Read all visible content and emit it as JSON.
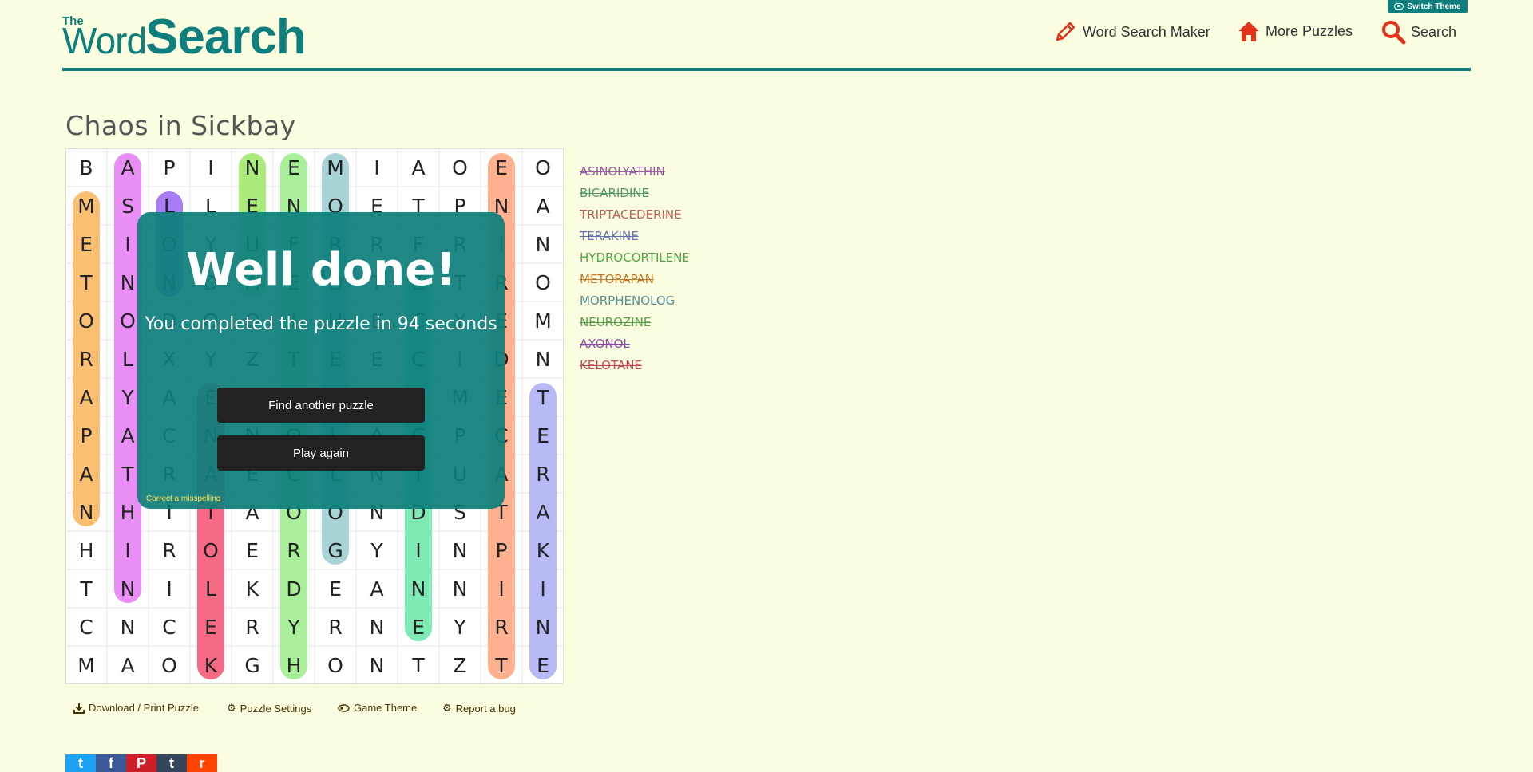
{
  "header": {
    "switch_theme": "Switch Theme",
    "logo_the": "The",
    "logo_word": "Word",
    "logo_search": "Search",
    "nav_maker": "Word Search Maker",
    "nav_more": "More Puzzles",
    "nav_search": "Search"
  },
  "puzzle": {
    "title": "Chaos in Sickbay",
    "rows": [
      [
        "B",
        "A",
        "P",
        "I",
        "N",
        "E",
        "M",
        "I",
        "A",
        "O",
        "E",
        "O"
      ],
      [
        "M",
        "S",
        "L",
        "L",
        "E",
        "N",
        "O",
        "E",
        "T",
        "P",
        "N",
        "A"
      ],
      [
        "E",
        "I",
        "O",
        "Y",
        "U",
        "F",
        "R",
        "R",
        "F",
        "R",
        "I",
        "N"
      ],
      [
        "T",
        "N",
        "N",
        "D",
        "A",
        "E",
        "O",
        "T",
        "E",
        "T",
        "R",
        "O"
      ],
      [
        "O",
        "O",
        "D",
        "O",
        "O",
        "I",
        "H",
        "E",
        "C",
        "Y",
        "E",
        "M"
      ],
      [
        "R",
        "L",
        "X",
        "Y",
        "Z",
        "T",
        "E",
        "E",
        "C",
        "I",
        "D",
        "N"
      ],
      [
        "A",
        "Y",
        "A",
        "E",
        "Z",
        "U",
        "O",
        "D",
        "C",
        "M",
        "E",
        "T"
      ],
      [
        "P",
        "A",
        "C",
        "N",
        "N",
        "O",
        "L",
        "A",
        "C",
        "P",
        "C",
        "E"
      ],
      [
        "A",
        "T",
        "R",
        "A",
        "E",
        "C",
        "L",
        "N",
        "I",
        "U",
        "A",
        "R"
      ],
      [
        "N",
        "H",
        "I",
        "T",
        "A",
        "O",
        "O",
        "N",
        "D",
        "S",
        "T",
        "A"
      ],
      [
        "H",
        "I",
        "R",
        "O",
        "E",
        "R",
        "G",
        "Y",
        "I",
        "N",
        "P",
        "K"
      ],
      [
        "T",
        "N",
        "I",
        "L",
        "K",
        "D",
        "E",
        "A",
        "N",
        "N",
        "I",
        "I"
      ],
      [
        "C",
        "N",
        "C",
        "E",
        "R",
        "Y",
        "R",
        "N",
        "E",
        "Y",
        "R",
        "N"
      ],
      [
        "M",
        "A",
        "O",
        "K",
        "G",
        "H",
        "O",
        "N",
        "T",
        "Z",
        "T",
        "E"
      ]
    ],
    "words": [
      {
        "text": "ASINOLYATHIN",
        "color": "#9a5aa8"
      },
      {
        "text": "BICARIDINE",
        "color": "#4f9a63"
      },
      {
        "text": "TRIPTACEDERINE",
        "color": "#b0645a"
      },
      {
        "text": "TERAKINE",
        "color": "#6470a8"
      },
      {
        "text": "HYDROCORTILENE",
        "color": "#58a048"
      },
      {
        "text": "METORAPAN",
        "color": "#c4782a"
      },
      {
        "text": "MORPHENOLOG",
        "color": "#5b8a8c"
      },
      {
        "text": "NEUROZINE",
        "color": "#58a048"
      },
      {
        "text": "AXONOL",
        "color": "#8a4aa6"
      },
      {
        "text": "KELOTANE",
        "color": "#c04a5a"
      }
    ]
  },
  "highlights": [
    {
      "col": 1,
      "from": 0,
      "to": 11,
      "color": "#e88ef5"
    },
    {
      "col": 0,
      "from": 1,
      "to": 9,
      "color": "#fbbf72"
    },
    {
      "col": 2,
      "from": 1,
      "to": 3,
      "color": "#a77df5"
    },
    {
      "col": 3,
      "from": 6,
      "to": 13,
      "color": "#f76a86"
    },
    {
      "col": 4,
      "from": 0,
      "to": 3,
      "color": "#a9ea7a"
    },
    {
      "col": 5,
      "from": 0,
      "to": 13,
      "color": "#a9ee98"
    },
    {
      "col": 6,
      "from": 0,
      "to": 10,
      "color": "#a8d3d7"
    },
    {
      "col": 8,
      "from": 3,
      "to": 12,
      "color": "#7eeab5"
    },
    {
      "col": 10,
      "from": 0,
      "to": 13,
      "color": "#ffb08e"
    },
    {
      "col": 11,
      "from": 6,
      "to": 13,
      "color": "#b7baf4"
    }
  ],
  "modal": {
    "title": "Well done!",
    "subtitle": "You completed the puzzle in 94 seconds",
    "find_another": "Find another puzzle",
    "play_again": "Play again",
    "misspelling": "Correct a misspelling"
  },
  "toolbar": {
    "download": "Download / Print Puzzle",
    "settings": "Puzzle Settings",
    "theme": "Game Theme",
    "bug": "Report a bug"
  },
  "social": [
    {
      "name": "twitter",
      "glyph": "t",
      "color": "#1da1f2"
    },
    {
      "name": "facebook",
      "glyph": "f",
      "color": "#3b5998"
    },
    {
      "name": "pinterest",
      "glyph": "P",
      "color": "#cb2027"
    },
    {
      "name": "tumblr",
      "glyph": "t",
      "color": "#35465c"
    },
    {
      "name": "reddit",
      "glyph": "r",
      "color": "#ff4500"
    }
  ]
}
